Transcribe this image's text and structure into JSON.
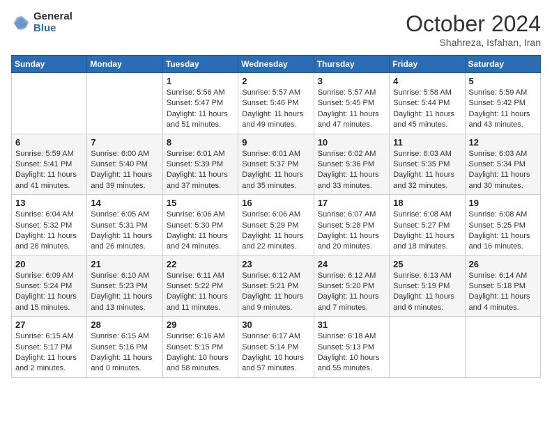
{
  "logo": {
    "general": "General",
    "blue": "Blue"
  },
  "header": {
    "month": "October 2024",
    "location": "Shahreza, Isfahan, Iran"
  },
  "weekdays": [
    "Sunday",
    "Monday",
    "Tuesday",
    "Wednesday",
    "Thursday",
    "Friday",
    "Saturday"
  ],
  "weeks": [
    [
      {
        "day": "",
        "sunrise": "",
        "sunset": "",
        "daylight": ""
      },
      {
        "day": "",
        "sunrise": "",
        "sunset": "",
        "daylight": ""
      },
      {
        "day": "1",
        "sunrise": "Sunrise: 5:56 AM",
        "sunset": "Sunset: 5:47 PM",
        "daylight": "Daylight: 11 hours and 51 minutes."
      },
      {
        "day": "2",
        "sunrise": "Sunrise: 5:57 AM",
        "sunset": "Sunset: 5:46 PM",
        "daylight": "Daylight: 11 hours and 49 minutes."
      },
      {
        "day": "3",
        "sunrise": "Sunrise: 5:57 AM",
        "sunset": "Sunset: 5:45 PM",
        "daylight": "Daylight: 11 hours and 47 minutes."
      },
      {
        "day": "4",
        "sunrise": "Sunrise: 5:58 AM",
        "sunset": "Sunset: 5:44 PM",
        "daylight": "Daylight: 11 hours and 45 minutes."
      },
      {
        "day": "5",
        "sunrise": "Sunrise: 5:59 AM",
        "sunset": "Sunset: 5:42 PM",
        "daylight": "Daylight: 11 hours and 43 minutes."
      }
    ],
    [
      {
        "day": "6",
        "sunrise": "Sunrise: 5:59 AM",
        "sunset": "Sunset: 5:41 PM",
        "daylight": "Daylight: 11 hours and 41 minutes."
      },
      {
        "day": "7",
        "sunrise": "Sunrise: 6:00 AM",
        "sunset": "Sunset: 5:40 PM",
        "daylight": "Daylight: 11 hours and 39 minutes."
      },
      {
        "day": "8",
        "sunrise": "Sunrise: 6:01 AM",
        "sunset": "Sunset: 5:39 PM",
        "daylight": "Daylight: 11 hours and 37 minutes."
      },
      {
        "day": "9",
        "sunrise": "Sunrise: 6:01 AM",
        "sunset": "Sunset: 5:37 PM",
        "daylight": "Daylight: 11 hours and 35 minutes."
      },
      {
        "day": "10",
        "sunrise": "Sunrise: 6:02 AM",
        "sunset": "Sunset: 5:36 PM",
        "daylight": "Daylight: 11 hours and 33 minutes."
      },
      {
        "day": "11",
        "sunrise": "Sunrise: 6:03 AM",
        "sunset": "Sunset: 5:35 PM",
        "daylight": "Daylight: 11 hours and 32 minutes."
      },
      {
        "day": "12",
        "sunrise": "Sunrise: 6:03 AM",
        "sunset": "Sunset: 5:34 PM",
        "daylight": "Daylight: 11 hours and 30 minutes."
      }
    ],
    [
      {
        "day": "13",
        "sunrise": "Sunrise: 6:04 AM",
        "sunset": "Sunset: 5:32 PM",
        "daylight": "Daylight: 11 hours and 28 minutes."
      },
      {
        "day": "14",
        "sunrise": "Sunrise: 6:05 AM",
        "sunset": "Sunset: 5:31 PM",
        "daylight": "Daylight: 11 hours and 26 minutes."
      },
      {
        "day": "15",
        "sunrise": "Sunrise: 6:06 AM",
        "sunset": "Sunset: 5:30 PM",
        "daylight": "Daylight: 11 hours and 24 minutes."
      },
      {
        "day": "16",
        "sunrise": "Sunrise: 6:06 AM",
        "sunset": "Sunset: 5:29 PM",
        "daylight": "Daylight: 11 hours and 22 minutes."
      },
      {
        "day": "17",
        "sunrise": "Sunrise: 6:07 AM",
        "sunset": "Sunset: 5:28 PM",
        "daylight": "Daylight: 11 hours and 20 minutes."
      },
      {
        "day": "18",
        "sunrise": "Sunrise: 6:08 AM",
        "sunset": "Sunset: 5:27 PM",
        "daylight": "Daylight: 11 hours and 18 minutes."
      },
      {
        "day": "19",
        "sunrise": "Sunrise: 6:08 AM",
        "sunset": "Sunset: 5:25 PM",
        "daylight": "Daylight: 11 hours and 16 minutes."
      }
    ],
    [
      {
        "day": "20",
        "sunrise": "Sunrise: 6:09 AM",
        "sunset": "Sunset: 5:24 PM",
        "daylight": "Daylight: 11 hours and 15 minutes."
      },
      {
        "day": "21",
        "sunrise": "Sunrise: 6:10 AM",
        "sunset": "Sunset: 5:23 PM",
        "daylight": "Daylight: 11 hours and 13 minutes."
      },
      {
        "day": "22",
        "sunrise": "Sunrise: 6:11 AM",
        "sunset": "Sunset: 5:22 PM",
        "daylight": "Daylight: 11 hours and 11 minutes."
      },
      {
        "day": "23",
        "sunrise": "Sunrise: 6:12 AM",
        "sunset": "Sunset: 5:21 PM",
        "daylight": "Daylight: 11 hours and 9 minutes."
      },
      {
        "day": "24",
        "sunrise": "Sunrise: 6:12 AM",
        "sunset": "Sunset: 5:20 PM",
        "daylight": "Daylight: 11 hours and 7 minutes."
      },
      {
        "day": "25",
        "sunrise": "Sunrise: 6:13 AM",
        "sunset": "Sunset: 5:19 PM",
        "daylight": "Daylight: 11 hours and 6 minutes."
      },
      {
        "day": "26",
        "sunrise": "Sunrise: 6:14 AM",
        "sunset": "Sunset: 5:18 PM",
        "daylight": "Daylight: 11 hours and 4 minutes."
      }
    ],
    [
      {
        "day": "27",
        "sunrise": "Sunrise: 6:15 AM",
        "sunset": "Sunset: 5:17 PM",
        "daylight": "Daylight: 11 hours and 2 minutes."
      },
      {
        "day": "28",
        "sunrise": "Sunrise: 6:15 AM",
        "sunset": "Sunset: 5:16 PM",
        "daylight": "Daylight: 11 hours and 0 minutes."
      },
      {
        "day": "29",
        "sunrise": "Sunrise: 6:16 AM",
        "sunset": "Sunset: 5:15 PM",
        "daylight": "Daylight: 10 hours and 58 minutes."
      },
      {
        "day": "30",
        "sunrise": "Sunrise: 6:17 AM",
        "sunset": "Sunset: 5:14 PM",
        "daylight": "Daylight: 10 hours and 57 minutes."
      },
      {
        "day": "31",
        "sunrise": "Sunrise: 6:18 AM",
        "sunset": "Sunset: 5:13 PM",
        "daylight": "Daylight: 10 hours and 55 minutes."
      },
      {
        "day": "",
        "sunrise": "",
        "sunset": "",
        "daylight": ""
      },
      {
        "day": "",
        "sunrise": "",
        "sunset": "",
        "daylight": ""
      }
    ]
  ]
}
